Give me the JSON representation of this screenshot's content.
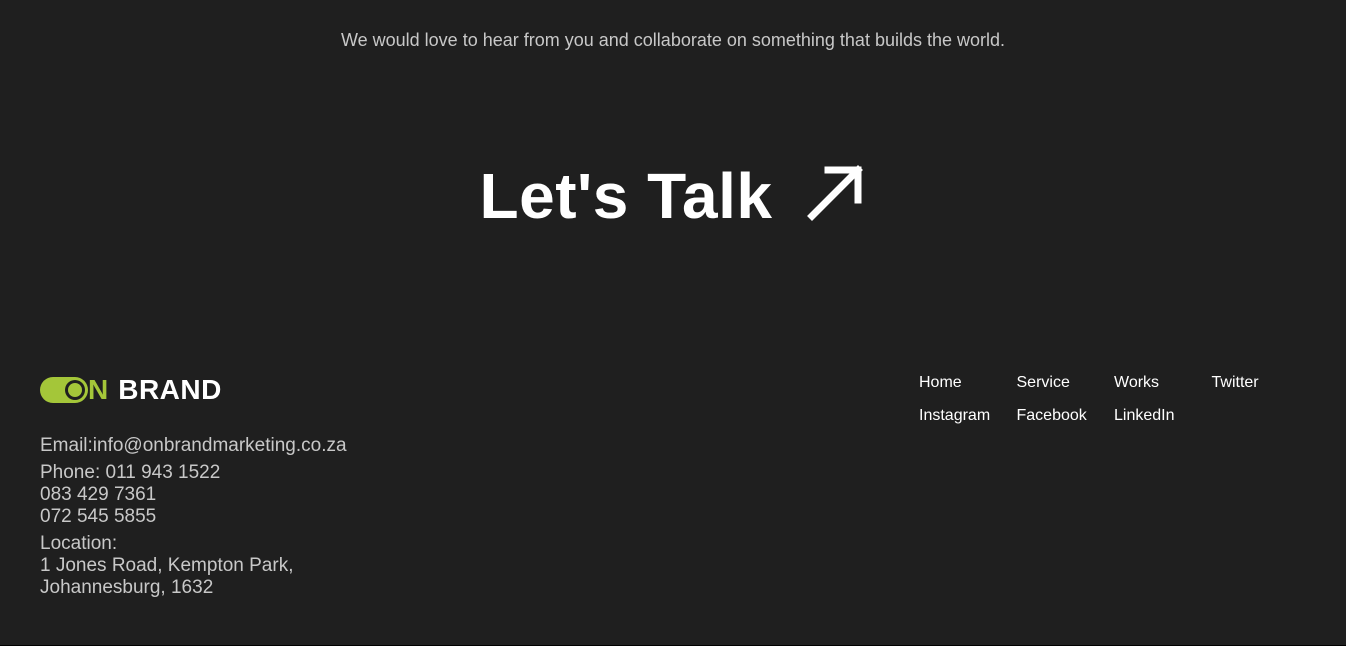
{
  "hero": {
    "tagline": "We would love to hear from you and collaborate on something that builds the world.",
    "cta_label": "Let's Talk",
    "cta_icon": "arrow-up-right-icon"
  },
  "footer": {
    "logo": {
      "prefix": "N",
      "word": "BRAND",
      "accent_color": "#a4c639"
    },
    "contact": {
      "email": "Email:info@onbrandmarketing.co.za",
      "phone_1": "Phone: 011 943 1522",
      "phone_2": "083 429 7361",
      "phone_3": "072 545 5855",
      "location_label": "Location:",
      "address_1": "1 Jones Road, Kempton Park,",
      "address_2": "Johannesburg, 1632"
    },
    "nav": [
      "Home",
      "Service",
      "Works",
      "Twitter",
      "Instagram",
      "Facebook",
      "LinkedIn"
    ]
  },
  "colors": {
    "background": "#1f1f1f",
    "text": "#ffffff",
    "muted_text": "#c8c8c8",
    "accent": "#a4c639"
  }
}
